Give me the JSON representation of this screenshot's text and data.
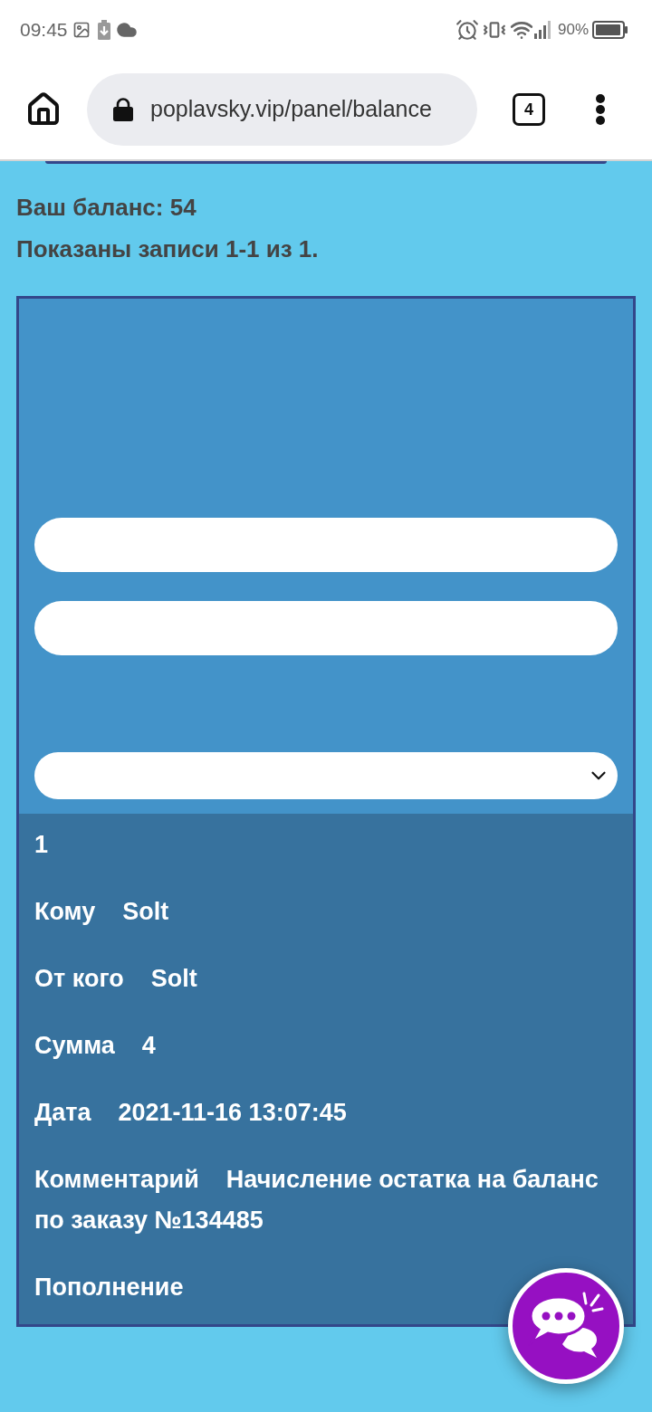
{
  "status_bar": {
    "time": "09:45",
    "battery": "90%"
  },
  "browser": {
    "url": "poplavsky.vip/panel/balance",
    "tab_count": "4"
  },
  "balance": "Ваш баланс: 54",
  "summary": "Показаны записи 1-1 из 1.",
  "filters": [
    {
      "kind": "input"
    },
    {
      "kind": "input"
    },
    {
      "kind": "select"
    }
  ],
  "record": {
    "number": "1",
    "rows": [
      {
        "label": "Кому",
        "value": "Solt"
      },
      {
        "label": "От кого",
        "value": "Solt"
      },
      {
        "label": "Сумма",
        "value": "4"
      },
      {
        "label": "Дата",
        "value": "2021-11-16 13:07:45"
      },
      {
        "label": "Комментарий",
        "value": "Начисление остатка на баланс по заказу №134485"
      }
    ],
    "type": "Пополнение"
  }
}
